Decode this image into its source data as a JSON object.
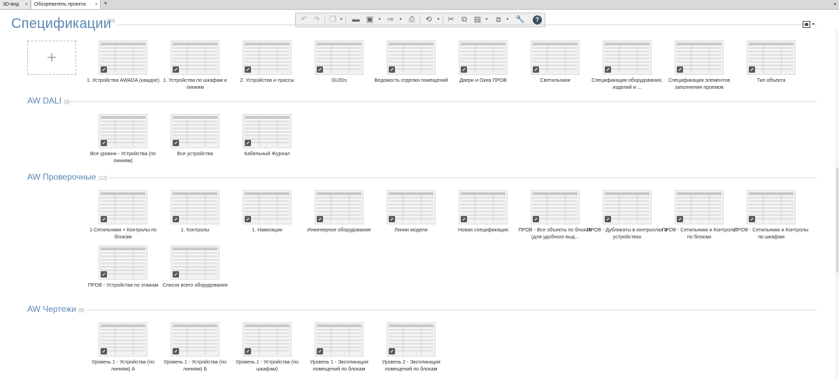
{
  "tabs": [
    {
      "label": "3D-вид",
      "close": "×"
    },
    {
      "label": "Обозреватель проекта",
      "close": "×"
    }
  ],
  "tab_add": "+",
  "tab_menu": "▾",
  "toolbar_icons": [
    "undo-icon",
    "redo-icon",
    "copy-view-icon",
    "open-folder-icon",
    "save-icon",
    "export-icon",
    "print-icon",
    "sync-icon",
    "cut-icon",
    "copy-icon",
    "paste-icon",
    "layers-icon",
    "settings-wrench-icon",
    "help-icon"
  ],
  "toolbar_arrow": "▾",
  "help_glyph": "?",
  "page": {
    "title": "Спецификации",
    "count": "(30)"
  },
  "add_tile": {
    "glyph": "+"
  },
  "sections": [
    {
      "title": "AW DALI",
      "count": "(3)"
    },
    {
      "title": "AW Проверочные",
      "count": "(12)"
    },
    {
      "title": "AW Чертежи",
      "count": "(5)"
    }
  ],
  "tiles": {
    "top": [
      "1. Устройства AWADA (каждое)",
      "1. Устройства по шкафам и линиям",
      "2. Устройства и трассы",
      "GUIDs",
      "Ведомость отделки помещений",
      "Двери и Окна ПРОВ",
      "Светильники",
      "Спецификация оборудования, изделий и ...",
      "Спецификация элементов заполнения проемов",
      "Тип объекта"
    ],
    "dali": [
      "Все уровни - Устройства (по линиям)",
      "Все устройства",
      "Кабельный Журнал"
    ],
    "check": [
      "1 Сетильники + Контролы по блокам",
      "1. Контролы",
      "1. Навигации",
      "Инженерное оборудование",
      "Линии модели",
      "Новая спецификация",
      "ПРОВ - Все объекты по блокам (для удобного выд...",
      "ПРОВ - Дубликаты в контроллах и устройствах",
      "ПРОВ - Сетильники и Контролы по блокам",
      "ПРОВ - Сетильники и Контролы по шкафам",
      "ПРОВ - Устройства по этажам",
      "Список всего оборудования"
    ],
    "drawings": [
      "Уровень 1 - Устройства (по линиям) А",
      "Уровень 1 - Устройства (по линиям) Б",
      "Уровень 1 - Устройства (по шкафам)",
      "Уровень 1 - Экспликация помещений по блокам",
      "Уровень 2 - Экспликация помещений по блокам"
    ]
  },
  "colors": {
    "accent": "#5b87b3",
    "tile_badge": "#595959"
  }
}
